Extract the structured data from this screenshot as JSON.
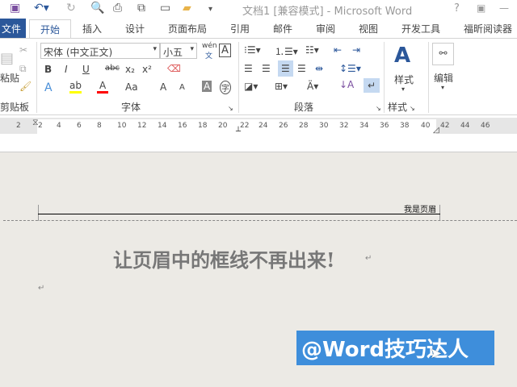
{
  "window": {
    "title": "文档1 [兼容模式] - Microsoft Word",
    "help": "?"
  },
  "tabs": {
    "file": "文件",
    "items": [
      "开始",
      "插入",
      "设计",
      "页面布局",
      "引用",
      "邮件",
      "审阅",
      "视图",
      "开发工具",
      "福昕阅读器"
    ]
  },
  "ribbon": {
    "clipboard": {
      "label": "剪贴板",
      "paste": "粘贴"
    },
    "font": {
      "label": "字体",
      "name": "宋体 (中文正文)",
      "size": "小五",
      "wen": "wén",
      "wen2": "文",
      "bold": "B",
      "italic": "I",
      "underline": "U",
      "strike": "abc",
      "sub": "x₂",
      "sup": "x²",
      "aa": "Aa",
      "grow": "A",
      "shrink": "A",
      "shade": "A",
      "char": "字"
    },
    "paragraph": {
      "label": "段落"
    },
    "styles": {
      "label": "样式",
      "button": "样式"
    },
    "editing": {
      "button": "编辑"
    },
    "colors": {
      "highlight": "#FFFF00",
      "font_color": "#FF0000",
      "accent": "#2B579A"
    }
  },
  "ruler": {
    "ticks": [
      "2",
      "2",
      "4",
      "6",
      "8",
      "10",
      "12",
      "14",
      "16",
      "18",
      "20",
      "22",
      "24",
      "26",
      "28",
      "30",
      "32",
      "34",
      "36",
      "38",
      "40",
      "42",
      "44",
      "46"
    ]
  },
  "document": {
    "header_text": "我是页眉",
    "heading": "让页眉中的框线不再出来!",
    "para_mark": "↵"
  },
  "watermark": {
    "text": "@Word技巧达人"
  }
}
